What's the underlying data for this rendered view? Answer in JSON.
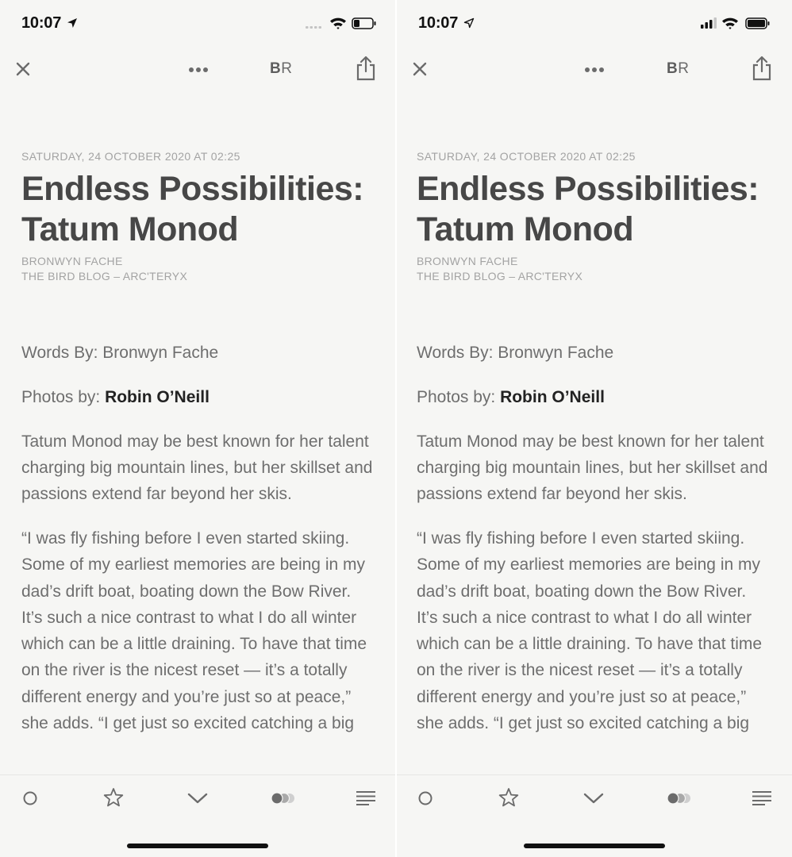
{
  "screens": [
    {
      "status": {
        "time": "10:07",
        "signal": "weak",
        "battery_level": 0.3
      },
      "toolbar": {
        "br_label_bold": "B",
        "br_label_regular": "R"
      },
      "article": {
        "date": "SATURDAY, 24 OCTOBER 2020 AT 02:25",
        "title": "Endless Possibilities: Tatum Monod",
        "author": "BRONWYN FACHE",
        "source": "THE BIRD BLOG – ARC'TERYX",
        "words_by": "Words By: Bronwyn Fache",
        "photos_by_label": "Photos by: ",
        "photos_by_name": "Robin O’Neill",
        "para1": "Tatum Monod may be best known for her talent charging big mountain lines, but her skillset and passions extend far beyond her skis.",
        "para2": "“I was fly fishing before I even started skiing. Some of my earliest memories are being in my dad’s drift boat, boating down the Bow River. It’s such a nice contrast to what I do all winter which can be a little draining. To have that time on the river is the nicest reset — it’s a totally different energy and you’re just so at peace,” she adds. “I get just so excited catching a big"
      }
    },
    {
      "status": {
        "time": "10:07",
        "signal": "full",
        "battery_level": 0.9
      },
      "toolbar": {
        "br_label_bold": "B",
        "br_label_regular": "R"
      },
      "article": {
        "date": "SATURDAY, 24 OCTOBER 2020 AT 02:25",
        "title": "Endless Possibilities: Tatum Monod",
        "author": "BRONWYN FACHE",
        "source": "THE BIRD BLOG – ARC'TERYX",
        "words_by": "Words By: Bronwyn Fache",
        "photos_by_label": "Photos by: ",
        "photos_by_name": "Robin O’Neill",
        "para1": "Tatum Monod may be best known for her talent charging big mountain lines, but her skillset and passions extend far beyond her skis.",
        "para2": "“I was fly fishing before I even started skiing. Some of my earliest memories are being in my dad’s drift boat, boating down the Bow River. It’s such a nice contrast to what I do all winter which can be a little draining. To have that time on the river is the nicest reset — it’s a totally different energy and you’re just so at peace,” she adds. “I get just so excited catching a big"
      }
    }
  ],
  "icons": {
    "close": "close-icon",
    "more": "more-icon",
    "share": "share-icon",
    "mark": "circle-icon",
    "favorite": "star-icon",
    "next": "chevron-down-icon",
    "theme": "toggle-icon",
    "list": "list-icon"
  },
  "colors": {
    "background": "#f6f6f4",
    "title": "#474747",
    "body": "#6e6e6e",
    "meta": "#a3a3a3",
    "icon": "#6b6b6b"
  }
}
